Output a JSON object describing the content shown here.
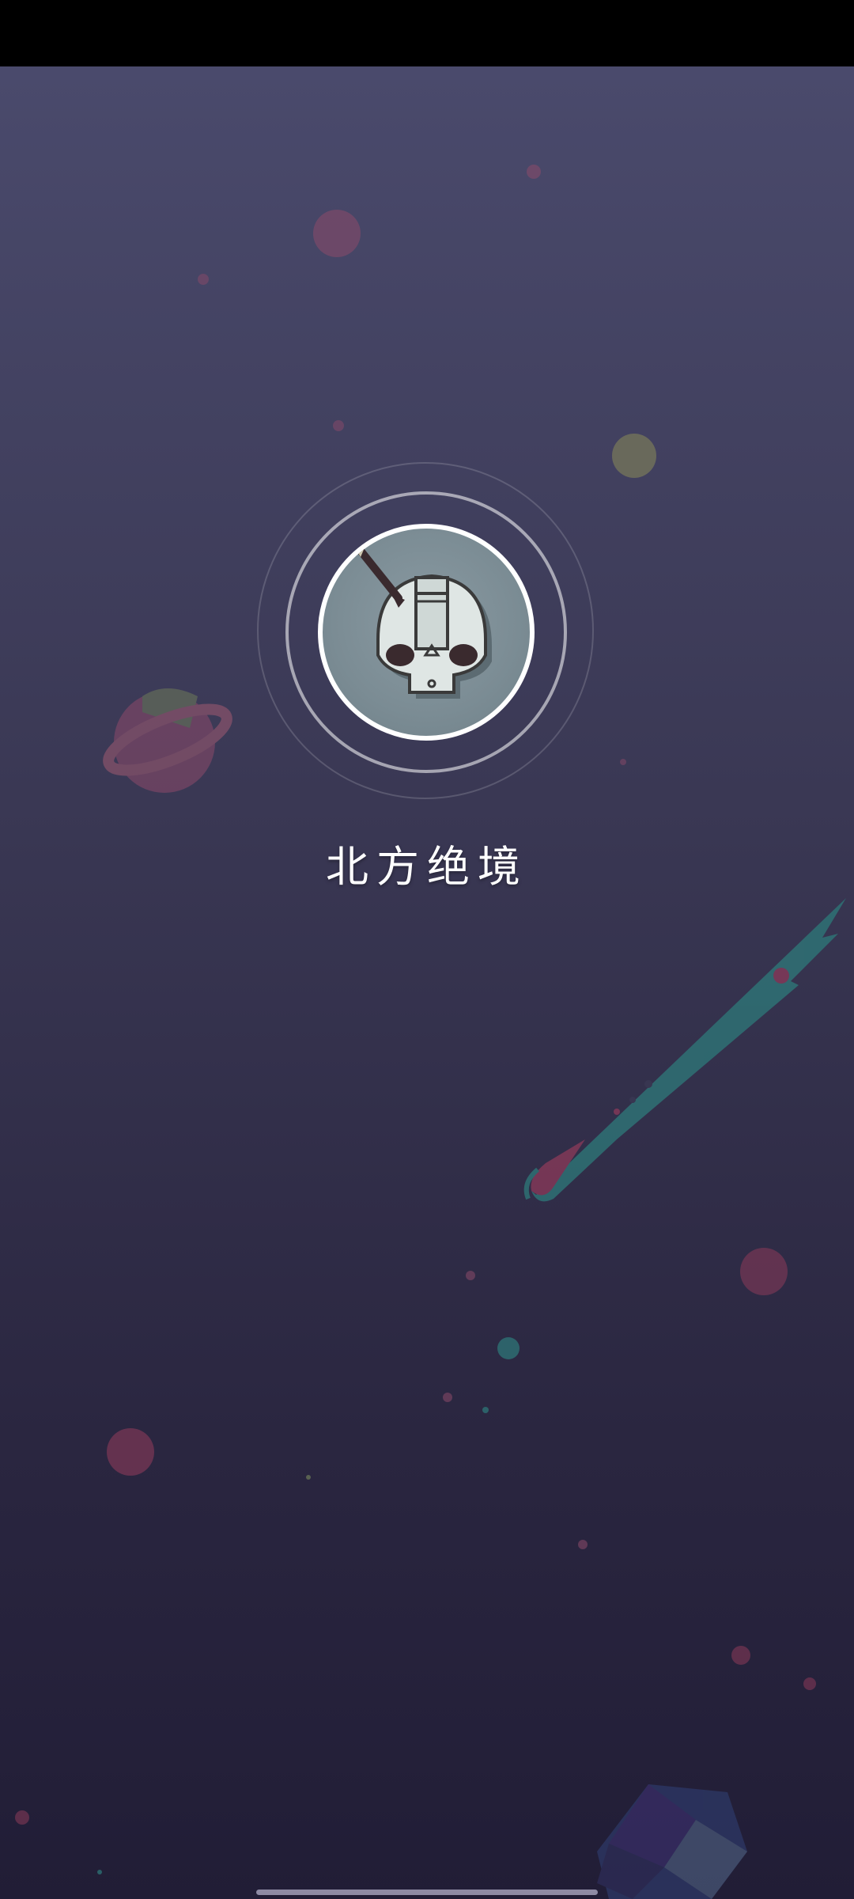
{
  "app": {
    "title": "北方绝境"
  },
  "icons": {
    "logo": "viking-skull-helmet-icon"
  },
  "colors": {
    "background_top": "#4a4a6c",
    "background_bottom": "#211d36",
    "planet_pink": "#8c4a6a",
    "comet_teal": "#2e7a7a",
    "logo_bg": "#7b8c94"
  }
}
